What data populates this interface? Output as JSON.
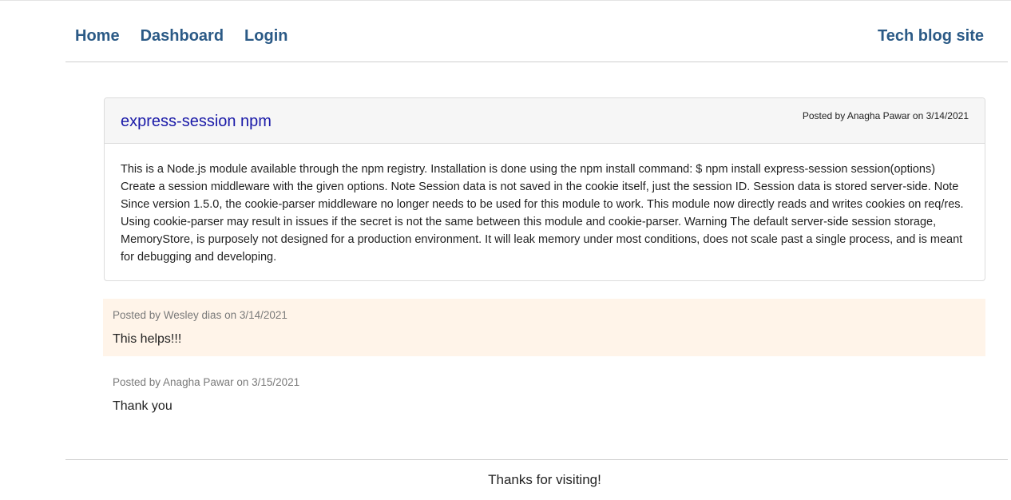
{
  "nav": {
    "links": [
      "Home",
      "Dashboard",
      "Login"
    ],
    "site_title": "Tech blog site"
  },
  "post": {
    "title": "express-session npm",
    "meta": "Posted by Anagha Pawar on 3/14/2021",
    "body": "This is a Node.js module available through the npm registry. Installation is done using the npm install command: $ npm install express-session session(options) Create a session middleware with the given options. Note Session data is not saved in the cookie itself, just the session ID. Session data is stored server-side. Note Since version 1.5.0, the cookie-parser middleware no longer needs to be used for this module to work. This module now directly reads and writes cookies on req/res. Using cookie-parser may result in issues if the secret is not the same between this module and cookie-parser. Warning The default server-side session storage, MemoryStore, is purposely not designed for a production environment. It will leak memory under most conditions, does not scale past a single process, and is meant for debugging and developing."
  },
  "comments": [
    {
      "meta": "Posted by Wesley dias on 3/14/2021",
      "text": "This helps!!!",
      "highlight_color": "#fff4e9"
    },
    {
      "meta": "Posted by Anagha Pawar on 3/15/2021",
      "text": "Thank you"
    }
  ],
  "footer": {
    "text": "Thanks for visiting!"
  },
  "colors": {
    "link": "#2b5a86",
    "post_title": "#1a1aa8"
  }
}
